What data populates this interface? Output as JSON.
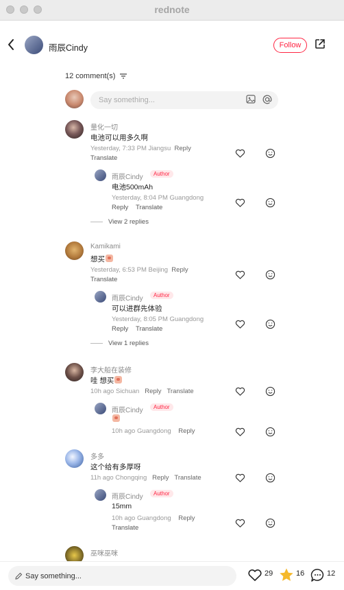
{
  "window": {
    "title": "rednote"
  },
  "header": {
    "author_name": "雨辰Cindy",
    "follow_label": "Follow"
  },
  "comments_header": {
    "count_label": "12 comment(s)"
  },
  "input": {
    "placeholder": "Say something..."
  },
  "comments": [
    {
      "user": "量化一切",
      "text": "电池可以用多久啊",
      "meta_time": "Yesterday, 7:33 PM Jiangsu",
      "reply_label": "Reply",
      "translate_label": "Translate",
      "reply": {
        "user": "雨辰Cindy",
        "badge": "Author",
        "text": "电池500mAh",
        "meta_time": "Yesterday, 8:04 PM Guangdong",
        "reply_label": "Reply",
        "translate_label": "Translate"
      },
      "view_replies": "View 2 replies"
    },
    {
      "user": "Kamikami",
      "text": "想买",
      "meta_time": "Yesterday, 6:53 PM Beijing",
      "reply_label": "Reply",
      "translate_label": "Translate",
      "reply": {
        "user": "雨辰Cindy",
        "badge": "Author",
        "text": "可以进群先体验",
        "meta_time": "Yesterday, 8:05 PM Guangdong",
        "reply_label": "Reply",
        "translate_label": "Translate"
      },
      "view_replies": "View 1 replies"
    },
    {
      "user": "李大船在装修",
      "text": "哇 想买",
      "meta_time": "10h ago Sichuan",
      "reply_label": "Reply",
      "translate_label": "Translate",
      "reply": {
        "user": "雨辰Cindy",
        "badge": "Author",
        "text": "",
        "meta_time": "10h ago Guangdong",
        "reply_label": "Reply"
      }
    },
    {
      "user": "多多",
      "text": "这个给有多厚呀",
      "meta_time": "11h ago Chongqing",
      "reply_label": "Reply",
      "translate_label": "Translate",
      "reply": {
        "user": "雨辰Cindy",
        "badge": "Author",
        "text": "15mm",
        "meta_time": "10h ago Guangdong",
        "reply_label": "Reply",
        "translate_label": "Translate"
      }
    },
    {
      "user": "巫咪巫咪"
    }
  ],
  "bottom": {
    "placeholder": "Say something...",
    "likes": "29",
    "collects": "16",
    "comments": "12"
  },
  "colors": {
    "accent": "#ff2442",
    "star": "#f5b92c",
    "muted": "#999999"
  }
}
